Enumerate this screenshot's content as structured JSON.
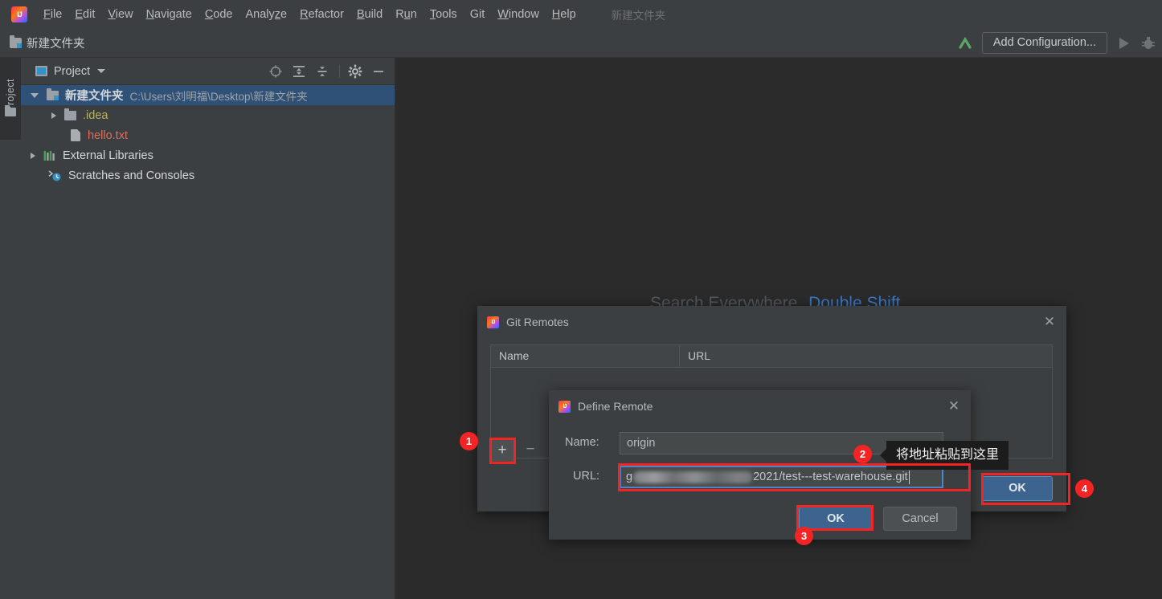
{
  "menubar": {
    "logo": "intellij-idea-logo",
    "items": [
      {
        "label": "File",
        "mnemonic": "F"
      },
      {
        "label": "Edit",
        "mnemonic": "E"
      },
      {
        "label": "View",
        "mnemonic": "V"
      },
      {
        "label": "Navigate",
        "mnemonic": "N"
      },
      {
        "label": "Code",
        "mnemonic": "C"
      },
      {
        "label": "Analyze",
        "mnemonic": "z"
      },
      {
        "label": "Refactor",
        "mnemonic": "R"
      },
      {
        "label": "Build",
        "mnemonic": "B"
      },
      {
        "label": "Run",
        "mnemonic": "u"
      },
      {
        "label": "Tools",
        "mnemonic": "T"
      },
      {
        "label": "Git",
        "mnemonic": ""
      },
      {
        "label": "Window",
        "mnemonic": "W"
      },
      {
        "label": "Help",
        "mnemonic": "H"
      }
    ],
    "project_name_dim": "新建文件夹"
  },
  "navbar": {
    "breadcrumb": "新建文件夹",
    "add_configuration": "Add Configuration...",
    "icons": [
      "arrow-up-icon",
      "run-icon",
      "debug-icon"
    ]
  },
  "toolstrip": {
    "project_tab": "Project",
    "folder_icon": "folder-icon"
  },
  "project_panel": {
    "title": "Project",
    "toolbar_icons": [
      "locate-target-icon",
      "expand-all-icon",
      "collapse-all-icon",
      "settings-gear-icon",
      "hide-minimize-icon"
    ],
    "tree": [
      {
        "label": "新建文件夹",
        "path": "C:\\Users\\刘明福\\Desktop\\新建文件夹",
        "icon": "module-folder-icon",
        "depth": 0,
        "state": "expanded",
        "selected": true,
        "color": "white-bold"
      },
      {
        "label": ".idea",
        "path": "",
        "icon": "folder-icon",
        "depth": 1,
        "state": "collapsed",
        "selected": false,
        "color": "yellow"
      },
      {
        "label": "hello.txt",
        "path": "",
        "icon": "text-file-icon",
        "depth": 2,
        "state": "leaf",
        "selected": false,
        "color": "red"
      },
      {
        "label": "External Libraries",
        "path": "",
        "icon": "libraries-icon",
        "depth": 0,
        "state": "collapsed",
        "selected": false,
        "color": "white"
      },
      {
        "label": "Scratches and Consoles",
        "path": "",
        "icon": "scratches-icon",
        "depth": 0,
        "state": "leaf",
        "selected": false,
        "color": "white"
      }
    ]
  },
  "editor": {
    "watermark_gray": "Search Everywhere",
    "watermark_blue": "Double Shift"
  },
  "git_remotes_dialog": {
    "title": "Git Remotes",
    "close_glyph": "✕",
    "columns": [
      "Name",
      "URL"
    ],
    "rows": [],
    "add_button": "+",
    "remove_button": "−",
    "ok_button": "OK"
  },
  "define_remote_dialog": {
    "title": "Define Remote",
    "close_glyph": "✕",
    "name_label": "Name:",
    "name_value": "origin",
    "url_label": "URL:",
    "url_prefix": "g",
    "url_redacted": "redacted-blurred-text",
    "url_suffix": "2021/test---test-warehouse.git",
    "ok_button": "OK",
    "cancel_button": "Cancel"
  },
  "tooltip": {
    "text": "将地址粘贴到这里"
  },
  "annotations": [
    {
      "number": "1",
      "target": "add-remote-button"
    },
    {
      "number": "2",
      "target": "url-input-field"
    },
    {
      "number": "3",
      "target": "define-remote-ok-button"
    },
    {
      "number": "4",
      "target": "git-remotes-ok-button"
    }
  ],
  "colors": {
    "annotation_red": "#f42424",
    "accent_blue": "#3c648f",
    "selection_blue": "#2f5077",
    "panel_bg": "#3c3f41",
    "editor_bg": "#2b2b2b",
    "link_blue": "#3a78c8"
  }
}
